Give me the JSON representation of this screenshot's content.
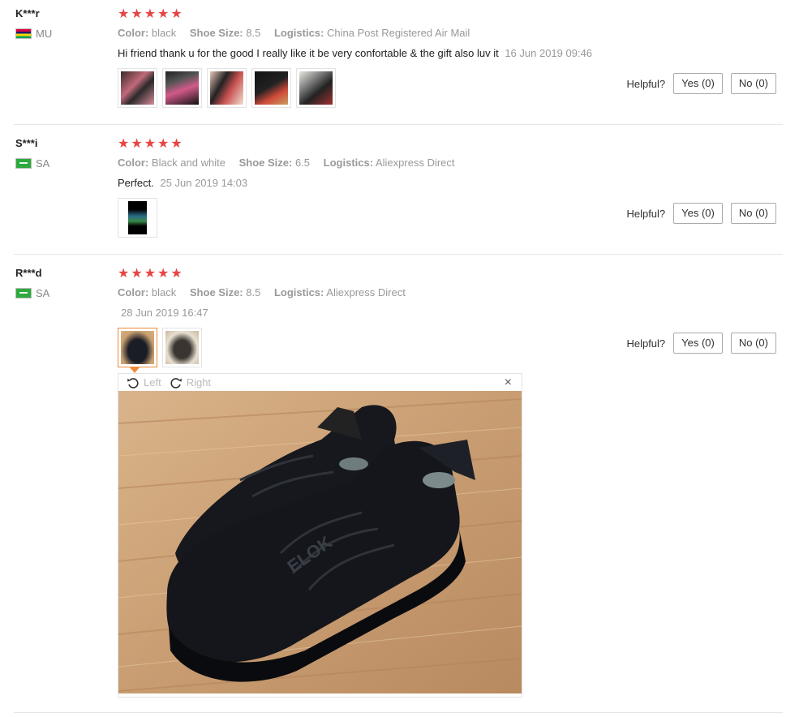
{
  "helpful_label": "Helpful?",
  "viewer": {
    "rotate_left": "Left",
    "rotate_right": "Right",
    "close": "×"
  },
  "reviews": [
    {
      "user": "K***r",
      "country": "MU",
      "stars": 5,
      "color_label": "Color:",
      "color": "black",
      "size_label": "Shoe Size:",
      "size": "8.5",
      "logistics_label": "Logistics:",
      "logistics": "China Post Registered Air Mail",
      "comment": "Hi friend thank u for the good I really like it be very confortable & the gift also luv it",
      "date": "16 Jun 2019 09:46",
      "yes": "Yes (0)",
      "no": "No (0)"
    },
    {
      "user": "S***i",
      "country": "SA",
      "stars": 5,
      "color_label": "Color:",
      "color": "Black and white",
      "size_label": "Shoe Size:",
      "size": "6.5",
      "logistics_label": "Logistics:",
      "logistics": "Aliexpress Direct",
      "comment": "Perfect.",
      "date": "25 Jun 2019 14:03",
      "yes": "Yes (0)",
      "no": "No (0)"
    },
    {
      "user": "R***d",
      "country": "SA",
      "stars": 5,
      "color_label": "Color:",
      "color": "black",
      "size_label": "Shoe Size:",
      "size": "8.5",
      "logistics_label": "Logistics:",
      "logistics": "Aliexpress Direct",
      "comment": "",
      "date": "28 Jun 2019 16:47",
      "yes": "Yes (0)",
      "no": "No (0)"
    }
  ],
  "colors": {
    "star": "#e64545",
    "active_thumb": "#f08a3a",
    "muted": "#999999"
  },
  "icons": [
    "star-icon",
    "flag-mu-icon",
    "flag-sa-icon",
    "rotate-left-icon",
    "rotate-right-icon",
    "close-icon"
  ]
}
